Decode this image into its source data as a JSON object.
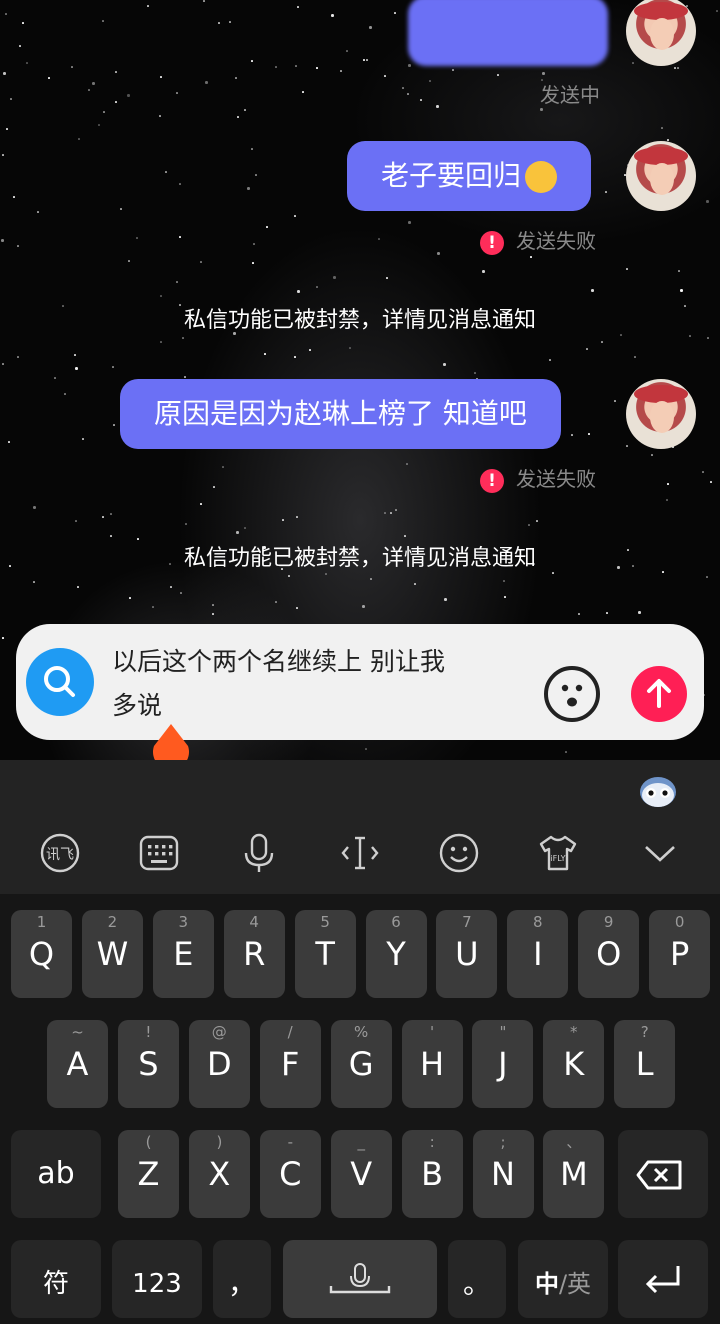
{
  "messages": [
    {
      "text": "",
      "status": "发送中",
      "status_type": "sending"
    },
    {
      "text": "老子要回归",
      "status": "发送失败",
      "status_type": "failed"
    },
    {
      "system": "私信功能已被封禁，详情见消息通知"
    },
    {
      "text": "原因是因为赵琳上榜了 知道吧",
      "status": "发送失败",
      "status_type": "failed"
    },
    {
      "system": "私信功能已被封禁，详情见消息通知"
    }
  ],
  "composer": {
    "line1": "以后这个两个名继续上 别让我",
    "line2": "多说"
  },
  "toolbar": {
    "icons": [
      "xunfei-icon",
      "keyboard-icon",
      "microphone-icon",
      "text-cursor-icon",
      "emoji-icon",
      "skin-icon",
      "collapse-icon"
    ]
  },
  "keyboard": {
    "row1": [
      {
        "key": "Q",
        "sub": "1"
      },
      {
        "key": "W",
        "sub": "2"
      },
      {
        "key": "E",
        "sub": "3"
      },
      {
        "key": "R",
        "sub": "4"
      },
      {
        "key": "T",
        "sub": "5"
      },
      {
        "key": "Y",
        "sub": "6"
      },
      {
        "key": "U",
        "sub": "7"
      },
      {
        "key": "I",
        "sub": "8"
      },
      {
        "key": "O",
        "sub": "9"
      },
      {
        "key": "P",
        "sub": "0"
      }
    ],
    "row2": [
      {
        "key": "A",
        "sub": "~"
      },
      {
        "key": "S",
        "sub": "!"
      },
      {
        "key": "D",
        "sub": "@"
      },
      {
        "key": "F",
        "sub": "/"
      },
      {
        "key": "G",
        "sub": "%"
      },
      {
        "key": "H",
        "sub": "'"
      },
      {
        "key": "J",
        "sub": "\""
      },
      {
        "key": "K",
        "sub": "*"
      },
      {
        "key": "L",
        "sub": "?"
      }
    ],
    "row3": [
      {
        "key": "Z",
        "sub": "("
      },
      {
        "key": "X",
        "sub": ")"
      },
      {
        "key": "C",
        "sub": "-"
      },
      {
        "key": "V",
        "sub": "_"
      },
      {
        "key": "B",
        "sub": ":"
      },
      {
        "key": "N",
        "sub": ";"
      },
      {
        "key": "M",
        "sub": "、"
      }
    ],
    "ab": "ab",
    "symbols": "符",
    "numbers": "123",
    "comma": "，",
    "period": "。",
    "lang_cn": "中",
    "lang_sep": "/",
    "lang_en": "英"
  },
  "colors": {
    "bubble": "#6b70f5",
    "error": "#ff2d5a",
    "send": "#ff1f55",
    "search": "#1f9bf3",
    "cursor_handle": "#ff5a1f"
  }
}
